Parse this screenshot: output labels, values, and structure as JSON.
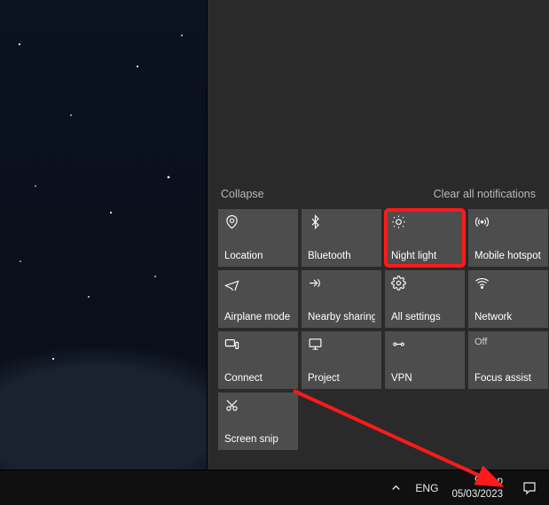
{
  "action_center": {
    "collapse_label": "Collapse",
    "clear_label": "Clear all notifications",
    "tiles": [
      {
        "id": "location",
        "label": "Location"
      },
      {
        "id": "bluetooth",
        "label": "Bluetooth"
      },
      {
        "id": "night-light",
        "label": "Night light"
      },
      {
        "id": "mobile-hotspot",
        "label": "Mobile hotspot"
      },
      {
        "id": "airplane-mode",
        "label": "Airplane mode"
      },
      {
        "id": "nearby-sharing",
        "label": "Nearby sharing"
      },
      {
        "id": "all-settings",
        "label": "All settings"
      },
      {
        "id": "network",
        "label": "Network"
      },
      {
        "id": "connect",
        "label": "Connect"
      },
      {
        "id": "project",
        "label": "Project"
      },
      {
        "id": "vpn",
        "label": "VPN"
      },
      {
        "id": "focus-assist",
        "label": "Focus assist",
        "state": "Off"
      },
      {
        "id": "screen-snip",
        "label": "Screen snip"
      }
    ]
  },
  "taskbar": {
    "ime_label": "ENG",
    "time": "9:45 p",
    "date": "05/03/2023"
  },
  "annotation": {
    "highlight_tile": "night-light",
    "arrow": true
  }
}
